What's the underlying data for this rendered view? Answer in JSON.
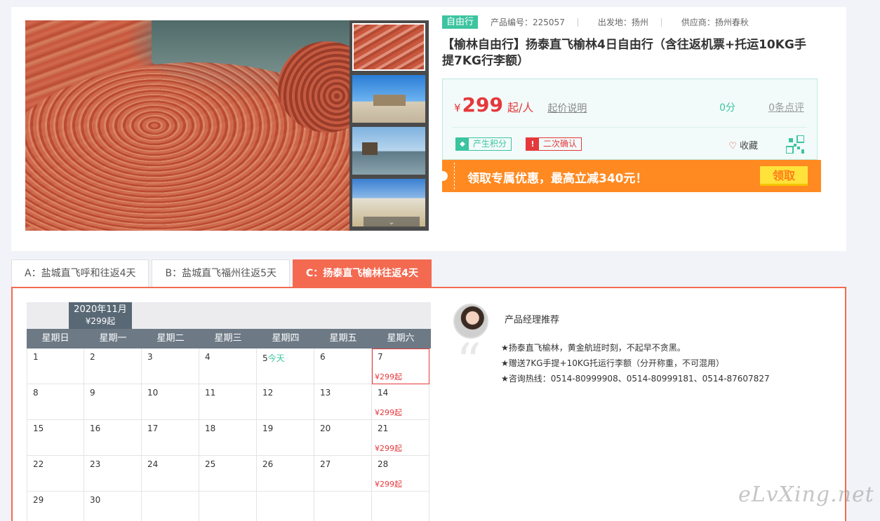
{
  "product": {
    "tag": "自由行",
    "code_label": "产品编号：225057",
    "origin_label": "出发地：扬州",
    "supplier_label": "供应商：扬州春秋",
    "title": "【榆林自由行】扬泰直飞榆林4日自由行（含往返机票+托运10KG手提7KG行李额）"
  },
  "price": {
    "currency": "¥",
    "amount": "299",
    "unit": "起/人",
    "desc_link": "起价说明",
    "score": "0分",
    "reviews": "0条点评",
    "badge_points": "产生积分",
    "badge_confirm": "二次确认",
    "favorite": "收藏"
  },
  "promo": {
    "text": "领取专属优惠，最高立减340元！",
    "button": "领取"
  },
  "tabs": [
    {
      "label": "A：盐城直飞呼和往返4天",
      "active": false
    },
    {
      "label": "B：盐城直飞福州往返5天",
      "active": false
    },
    {
      "label": "C：扬泰直飞榆林往返4天",
      "active": true
    }
  ],
  "calendar": {
    "month": "2020年11月",
    "month_price": "¥299起",
    "weekdays": [
      "星期日",
      "星期一",
      "星期二",
      "星期三",
      "星期四",
      "星期五",
      "星期六"
    ],
    "today_label": "今天",
    "days": [
      {
        "d": "1"
      },
      {
        "d": "2"
      },
      {
        "d": "3"
      },
      {
        "d": "4"
      },
      {
        "d": "5",
        "today": true
      },
      {
        "d": "6"
      },
      {
        "d": "7",
        "price": "¥299起",
        "selected": true
      },
      {
        "d": "8"
      },
      {
        "d": "9"
      },
      {
        "d": "10"
      },
      {
        "d": "11"
      },
      {
        "d": "12"
      },
      {
        "d": "13"
      },
      {
        "d": "14",
        "price": "¥299起"
      },
      {
        "d": "15"
      },
      {
        "d": "16"
      },
      {
        "d": "17"
      },
      {
        "d": "18"
      },
      {
        "d": "19"
      },
      {
        "d": "20"
      },
      {
        "d": "21",
        "price": "¥299起"
      },
      {
        "d": "22"
      },
      {
        "d": "23"
      },
      {
        "d": "24"
      },
      {
        "d": "25"
      },
      {
        "d": "26"
      },
      {
        "d": "27"
      },
      {
        "d": "28",
        "price": "¥299起"
      },
      {
        "d": "29"
      },
      {
        "d": "30"
      },
      {
        "d": ""
      },
      {
        "d": ""
      },
      {
        "d": ""
      },
      {
        "d": ""
      },
      {
        "d": ""
      }
    ]
  },
  "manager": {
    "title": "产品经理推荐",
    "lines": [
      "★扬泰直飞榆林，黄金航班时刻，不起早不贪黑。",
      "★赠送7KG手提+10KG托运行李额（分开称重，不可混用）",
      "★咨询热线：0514-80999908、0514-80999181、0514-87607827"
    ]
  },
  "watermark": "eLvXing.net"
}
